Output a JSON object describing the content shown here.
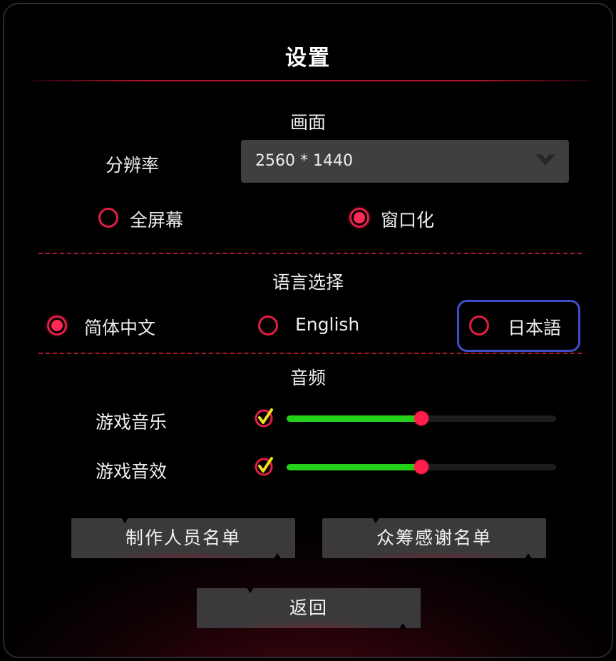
{
  "dialog": {
    "title": "设置",
    "display": {
      "section_title": "画面",
      "resolution_label": "分辨率",
      "resolution_value": "2560 * 1440",
      "fullscreen_label": "全屏幕",
      "windowed_label": "窗口化",
      "selected_mode": "windowed"
    },
    "language": {
      "section_title": "语言选择",
      "options": [
        {
          "label": "简体中文",
          "selected": true
        },
        {
          "label": "English",
          "selected": false
        },
        {
          "label": "日本語",
          "selected": false
        }
      ]
    },
    "audio": {
      "section_title": "音频",
      "music_label": "游戏音乐",
      "sfx_label": "游戏音效",
      "music_enabled": true,
      "sfx_enabled": true,
      "music_level": 0.5,
      "sfx_level": 0.5
    },
    "buttons": {
      "credits": "制作人员名单",
      "crowdfunding_thanks": "众筹感谢名单",
      "back": "返回"
    }
  },
  "colors": {
    "accent_red": "#e21e44",
    "slider_green": "#24d018",
    "highlight_blue": "#3e4ec8"
  },
  "icons": {
    "dropdown": "chevron-down-icon",
    "check": "checkmark-icon"
  }
}
